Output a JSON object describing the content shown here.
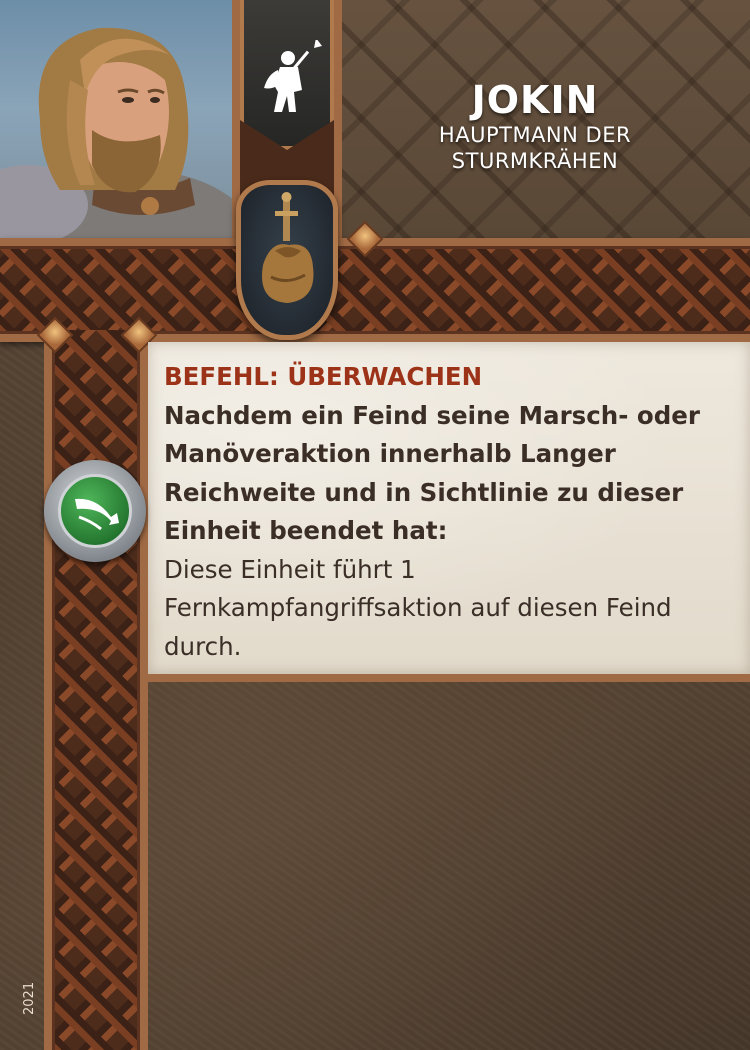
{
  "card": {
    "name": "JOKIN",
    "subtitle_line1": "HAUPTMANN DER",
    "subtitle_line2": "STURMKRÄHEN",
    "class_icon": "spearman-icon",
    "item_icon": "sword-and-pouch-icon",
    "portrait": "bearded-warrior-portrait",
    "rules": {
      "heading": "BEFEHL: ÜBERWACHEN",
      "trigger_lines": [
        "Nachdem ein Feind seine Marsch- oder",
        "Manöveraktion innerhalb Langer",
        "Reichweite und in Sichtlinie zu dieser",
        "Einheit beendet hat:"
      ],
      "effect_lines": [
        "Diese Einheit führt 1",
        "Fernkampfangriffsaktion auf diesen Feind",
        "durch."
      ]
    },
    "action_token_icon": "horn-icon",
    "copyright_year": "2021"
  },
  "colors": {
    "heading": "#9c3217",
    "panel": "#e9e3d7",
    "frame": "#a06a44",
    "token": "#2e8f3a"
  }
}
